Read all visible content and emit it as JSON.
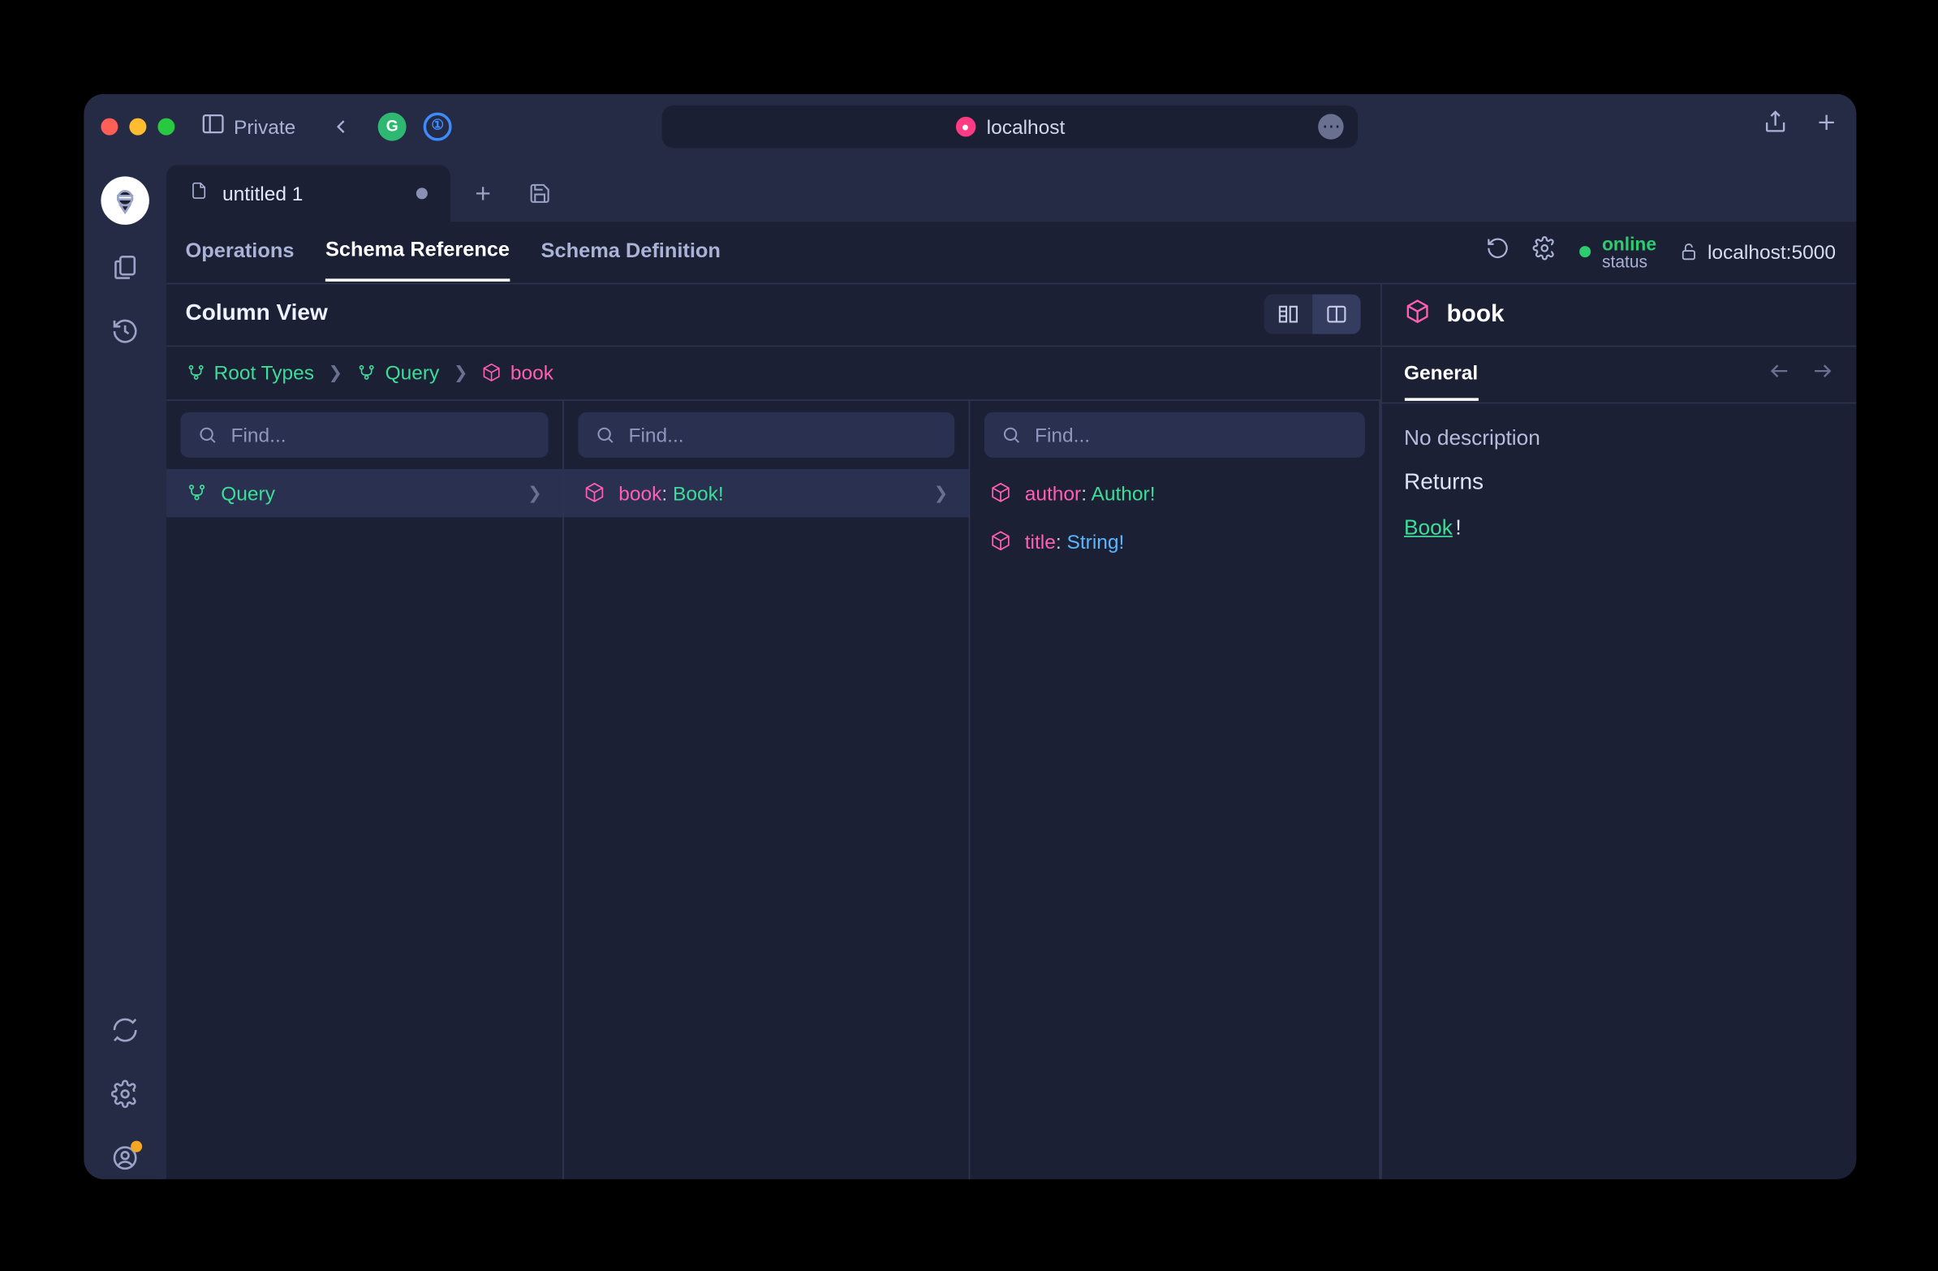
{
  "browser": {
    "private_label": "Private",
    "url_host": "localhost"
  },
  "tab": {
    "title": "untitled 1"
  },
  "subtabs": {
    "operations": "Operations",
    "schema_reference": "Schema Reference",
    "schema_definition": "Schema Definition"
  },
  "status": {
    "label": "online",
    "sub": "status"
  },
  "endpoint": "localhost:5000",
  "titlebar": "Column View",
  "breadcrumbs": {
    "root": "Root Types",
    "query": "Query",
    "book": "book"
  },
  "search_placeholder": "Find...",
  "col1": {
    "query": "Query"
  },
  "col2": {
    "book_field": "book",
    "book_type": "Book!"
  },
  "col3": {
    "author_field": "author",
    "author_type": "Author!",
    "title_field": "title",
    "title_type": "String!"
  },
  "details": {
    "title": "book",
    "tab_general": "General",
    "no_description": "No description",
    "returns_label": "Returns",
    "return_type": "Book",
    "return_bang": "!"
  }
}
